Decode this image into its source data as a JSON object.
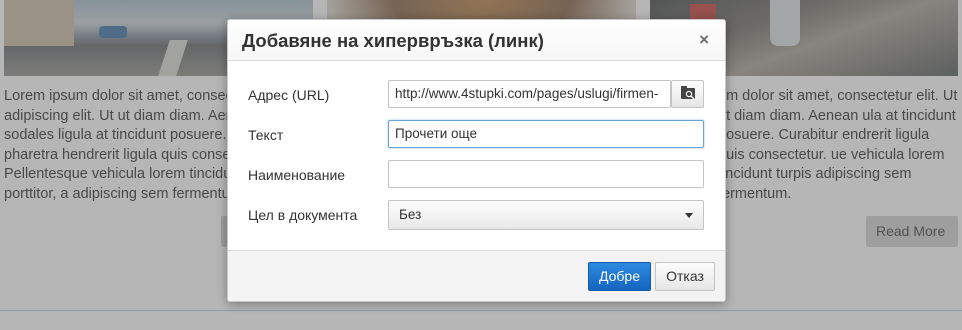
{
  "background": {
    "para1": "Lorem ipsum dolor sit amet, consectetur adipiscing elit. Ut ut diam diam. Aenean sodales ligula at tincidunt posuere. Curabitur pharetra hendrerit ligula quis consectetur. Pellentesque vehicula lorem tincidunt turpis porttitor, a adipiscing sem fermentum.",
    "para3": "um dolor sit amet, consectetur elit. Ut ut diam diam. Aenean ula at tincidunt posuere. Curabitur endrerit ligula quis consectetur. ue vehicula lorem tincidunt turpis adipiscing sem fermentum.",
    "read_more": "Read More"
  },
  "dialog": {
    "title": "Добавяне на хипервръзка (линк)",
    "close": "×",
    "fields": {
      "url_label": "Адрес (URL)",
      "url_value": "http://www.4stupki.com/pages/uslugi/firmen-",
      "text_label": "Текст",
      "text_value": "Прочети още",
      "title_label": "Наименование",
      "title_value": "",
      "target_label": "Цел в документа",
      "target_value": "Без"
    },
    "buttons": {
      "ok": "Добре",
      "cancel": "Отказ"
    }
  },
  "icons": {
    "browse": "browse-server-icon",
    "caret": "chevron-down-icon",
    "close": "close-icon"
  },
  "colors": {
    "primary_button": "#1565c0",
    "focus_border": "#6aa4d8"
  }
}
